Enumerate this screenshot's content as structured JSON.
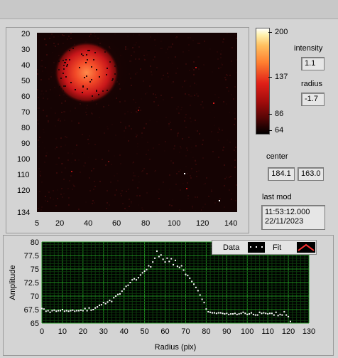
{
  "image_panel": {
    "y_ticks": [
      "20",
      "30",
      "40",
      "50",
      "60",
      "70",
      "80",
      "90",
      "100",
      "110",
      "120",
      "134"
    ],
    "x_ticks": [
      "5",
      "20",
      "40",
      "60",
      "80",
      "100",
      "120",
      "140"
    ]
  },
  "colorbar": {
    "ticks": [
      "200",
      "137",
      "86",
      "64"
    ],
    "colors": {
      "low": "#000000",
      "mid": "#cc1010",
      "high": "#ffffe0"
    }
  },
  "indicators": {
    "intensity_label": "intensity",
    "intensity_value": "1.1",
    "radius_label": "radius",
    "radius_value": "-1.7",
    "center_label": "center",
    "center_x": "184.1",
    "center_y": "163.0",
    "last_mod_label": "last mod",
    "last_mod_time": "11:53:12.000",
    "last_mod_date": "22/11/2023"
  },
  "legend": {
    "data_label": "Data",
    "fit_label": "Fit"
  },
  "chart_data": {
    "type": "scatter",
    "xlabel": "Radius (pix)",
    "ylabel": "Amplitude",
    "xlim": [
      0,
      130
    ],
    "ylim": [
      65,
      80
    ],
    "x_ticks": [
      0,
      10,
      20,
      30,
      40,
      50,
      60,
      70,
      80,
      90,
      100,
      110,
      120,
      130
    ],
    "y_ticks": [
      65,
      67.5,
      70,
      72.5,
      75,
      77.5,
      80
    ],
    "grid": true,
    "legend_position": "top-right",
    "plot_bg": "#000000",
    "grid_color": "#1f8f1f",
    "series": [
      {
        "name": "Data",
        "x": [
          0,
          1,
          2,
          3,
          4,
          5,
          6,
          7,
          8,
          9,
          10,
          11,
          12,
          13,
          14,
          15,
          16,
          17,
          18,
          19,
          20,
          21,
          22,
          23,
          24,
          25,
          26,
          27,
          28,
          29,
          30,
          31,
          32,
          33,
          34,
          35,
          36,
          37,
          38,
          39,
          40,
          41,
          42,
          43,
          44,
          45,
          46,
          47,
          48,
          49,
          50,
          51,
          52,
          53,
          54,
          55,
          56,
          57,
          58,
          59,
          60,
          61,
          62,
          63,
          64,
          65,
          66,
          67,
          68,
          69,
          70,
          71,
          72,
          73,
          74,
          75,
          76,
          77,
          78,
          79,
          80,
          81,
          82,
          83,
          84,
          85,
          86,
          87,
          88,
          89,
          90,
          91,
          92,
          93,
          94,
          95,
          96,
          97,
          98,
          99,
          100,
          101,
          102,
          103,
          104,
          105,
          106,
          107,
          108,
          109,
          110,
          111,
          112,
          113,
          114,
          115,
          116,
          117,
          118,
          119,
          120,
          121
        ],
        "y": [
          67.7,
          67.6,
          67.2,
          67.3,
          67.0,
          67.3,
          67.4,
          67.2,
          67.3,
          67.3,
          67.5,
          67.2,
          67.3,
          67.2,
          67.3,
          67.4,
          67.2,
          67.3,
          67.3,
          67.4,
          67.3,
          67.7,
          67.3,
          67.8,
          67.4,
          67.5,
          67.8,
          68.0,
          68.3,
          68.4,
          68.8,
          68.6,
          68.9,
          69.2,
          69.0,
          69.7,
          70.0,
          70.3,
          70.4,
          70.9,
          71.3,
          71.8,
          72.0,
          72.5,
          73.0,
          73.2,
          73.0,
          73.4,
          73.9,
          74.3,
          74.6,
          74.9,
          75.6,
          75.4,
          76.3,
          77.0,
          78.3,
          77.3,
          77.6,
          76.8,
          76.3,
          77.0,
          76.4,
          76.9,
          75.8,
          76.6,
          75.5,
          75.3,
          75.6,
          74.8,
          74.0,
          73.8,
          73.3,
          72.7,
          72.2,
          71.6,
          71.0,
          70.2,
          69.4,
          68.8,
          67.6,
          67.1,
          67.0,
          66.9,
          66.9,
          66.8,
          66.9,
          66.9,
          66.8,
          66.7,
          66.8,
          66.6,
          66.7,
          66.7,
          66.8,
          66.6,
          66.7,
          66.8,
          67.0,
          66.8,
          66.6,
          66.7,
          66.9,
          66.6,
          66.5,
          66.5,
          67.0,
          66.8,
          66.9,
          66.8,
          66.7,
          66.8,
          66.8,
          66.5,
          67.0,
          66.4,
          66.6,
          66.5,
          67.1,
          66.5,
          66.2,
          65.3
        ]
      }
    ]
  }
}
